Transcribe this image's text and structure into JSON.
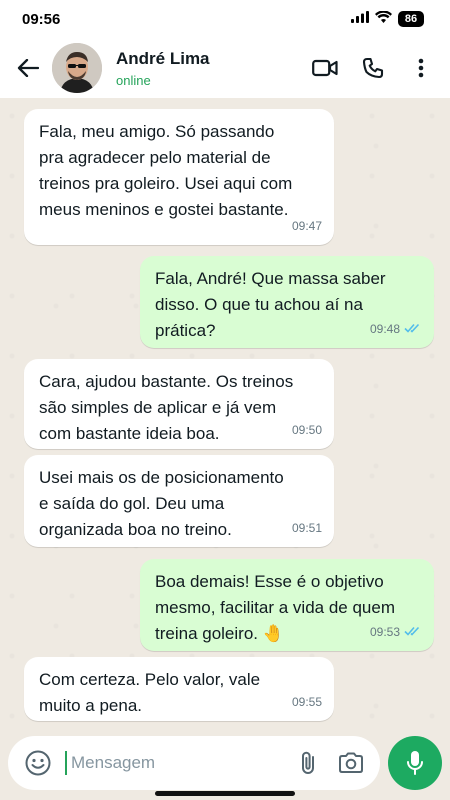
{
  "status_bar": {
    "time": "09:56",
    "battery": "86"
  },
  "header": {
    "contact_name": "André Lima",
    "contact_status": "online",
    "icons": [
      "back-arrow-icon",
      "video-call-icon",
      "phone-icon",
      "more-options-icon"
    ]
  },
  "messages": [
    {
      "direction": "incoming",
      "text": "Fala, meu amigo. Só passando\npra agradecer pelo material de\ntreinos pra goleiro. Usei aqui com\nmeus meninos e gostei bastante.",
      "time": "09:47"
    },
    {
      "direction": "outgoing",
      "text": "Fala, André! Que massa saber\ndisso. O que tu achou aí na\nprática?",
      "time": "09:48",
      "read": true
    },
    {
      "direction": "incoming",
      "text": "Cara, ajudou bastante. Os treinos\nsão simples de aplicar e já vem\ncom bastante ideia boa.",
      "time": "09:50"
    },
    {
      "direction": "incoming",
      "text": "Usei mais os de posicionamento\ne saída do gol. Deu uma\norganizada boa no treino.",
      "time": "09:51"
    },
    {
      "direction": "outgoing",
      "text": "Boa demais! Esse é o objetivo\nmesmo, facilitar a vida de quem\ntreina goleiro. 🤚",
      "time": "09:53",
      "read": true
    },
    {
      "direction": "incoming",
      "text": "Com certeza. Pelo valor, vale\nmuito a pena.",
      "time": "09:55"
    }
  ],
  "composer": {
    "placeholder": "Mensagem"
  },
  "colors": {
    "incoming_bubble": "#ffffff",
    "outgoing_bubble": "#d9fdd3",
    "accent_green": "#1daa61",
    "read_ticks": "#53bdeb",
    "chat_background": "#efeae2"
  }
}
